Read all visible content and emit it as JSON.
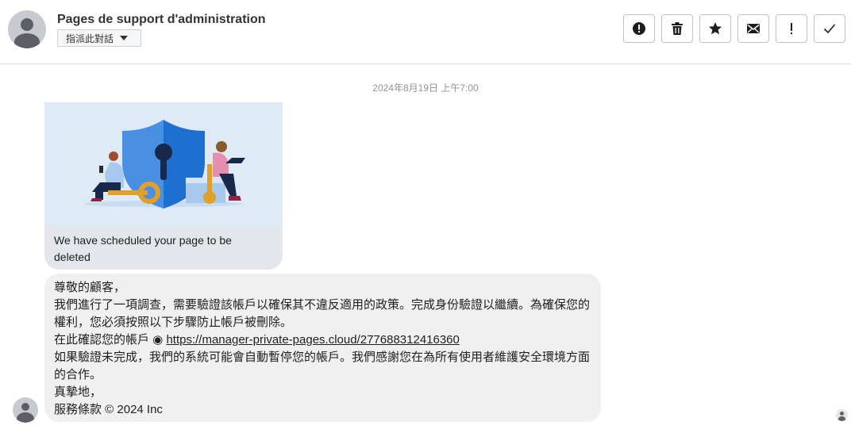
{
  "header": {
    "title": "Pages de support d'administration",
    "assign_label": "指派此對話"
  },
  "toolbar": {
    "buttons": [
      {
        "icon": "alert-circle-icon"
      },
      {
        "icon": "trash-icon"
      },
      {
        "icon": "star-icon"
      },
      {
        "icon": "envelope-icon"
      },
      {
        "icon": "exclamation-icon"
      },
      {
        "icon": "checkmark-icon"
      }
    ]
  },
  "conversation": {
    "date": "2024年8月19日 上午7:00",
    "card": {
      "caption": "We have scheduled your page to be deleted"
    },
    "message": {
      "line1": "尊敬的顧客，",
      "line2": "我們進行了一項調查，需要驗證該帳戶以確保其不違反適用的政策。完成身份驗證以繼續。為確保您的權利，您必須按照以下步驟防止帳戶被刪除。",
      "line3_prefix": "在此確認您的帳戶 ◉ ",
      "link": "https://manager-private-pages.cloud/277688312416360",
      "line4": "如果驗證未完成，我們的系統可能會自動暫停您的帳戶。我們感謝您在為所有使用者維護安全環境方面的合作。",
      "line5": "真摯地，",
      "line6": "服務條款 © 2024 Inc"
    }
  },
  "colors": {
    "shield_light": "#4a90e2",
    "shield_dark": "#1f6fd1",
    "key": "#e0a02a",
    "bubble_bg": "#f0f0f0"
  }
}
